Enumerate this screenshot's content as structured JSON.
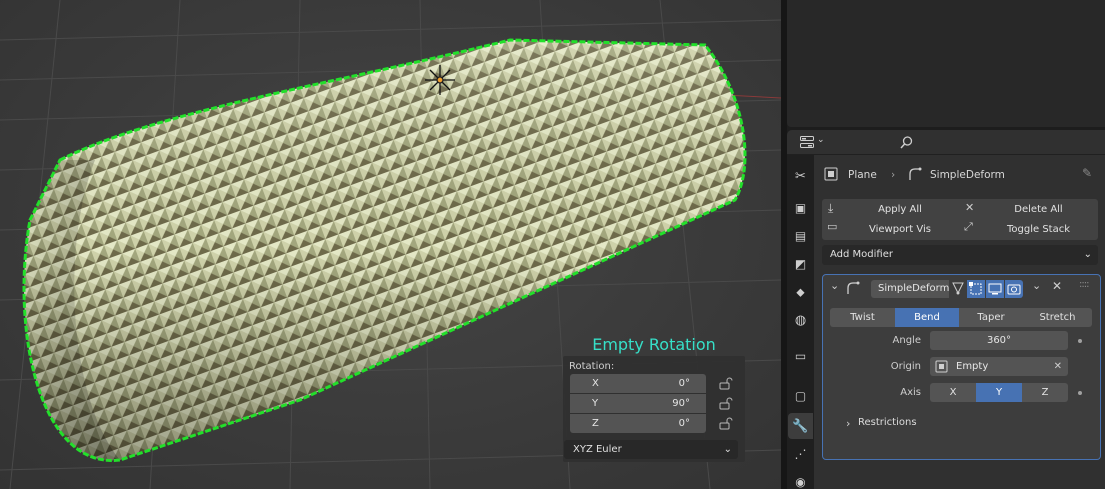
{
  "viewport": {
    "overlay_title": "Empty Rotation",
    "rotation_panel": {
      "label": "Rotation:",
      "rows": [
        {
          "axis": "X",
          "value": "0°"
        },
        {
          "axis": "Y",
          "value": "90°"
        },
        {
          "axis": "Z",
          "value": "0°"
        }
      ],
      "mode": "XYZ Euler"
    }
  },
  "properties": {
    "breadcrumb": {
      "object": "Plane",
      "modifier": "SimpleDeform"
    },
    "toolbar": {
      "apply_all": "Apply All",
      "delete_all": "Delete All",
      "viewport_vis": "Viewport Vis",
      "toggle_stack": "Toggle Stack"
    },
    "add_modifier": "Add Modifier",
    "modifier": {
      "name": "SimpleDeform",
      "modes": [
        "Twist",
        "Bend",
        "Taper",
        "Stretch"
      ],
      "active_mode": "Bend",
      "angle_label": "Angle",
      "angle_value": "360°",
      "origin_label": "Origin",
      "origin_value": "Empty",
      "axis_label": "Axis",
      "axes": [
        "X",
        "Y",
        "Z"
      ],
      "active_axis": "Y",
      "restrictions": "Restrictions"
    }
  },
  "colors": {
    "accent": "#4772b3",
    "selection_outline": "#22e02a",
    "mesh": "#c8cca0",
    "overlay_text": "#36e0c8"
  }
}
